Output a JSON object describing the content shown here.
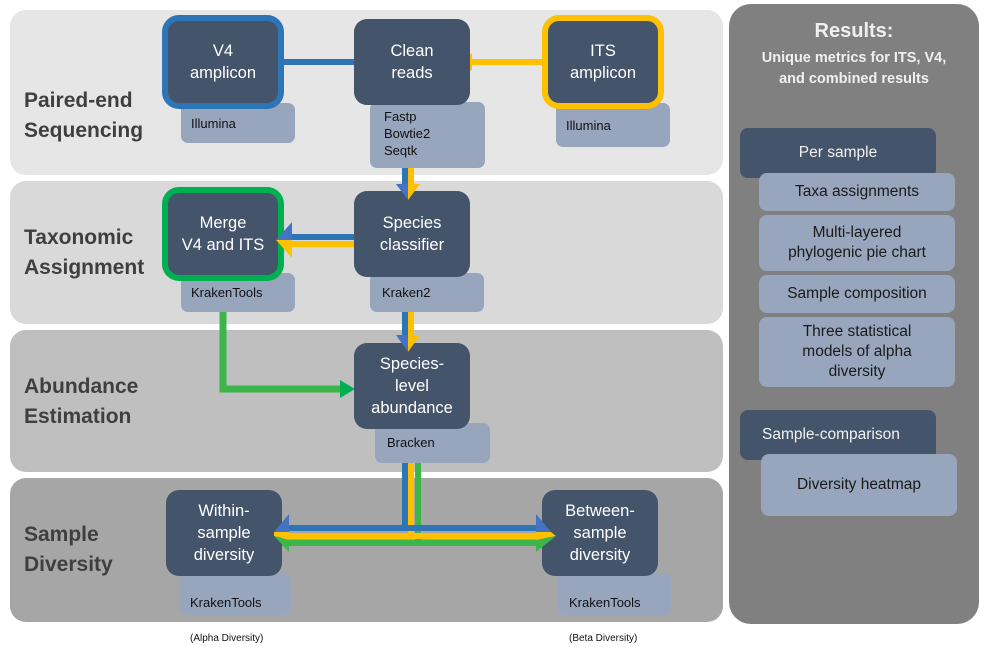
{
  "colors": {
    "v4": "#2e75b6",
    "its": "#ffc000",
    "merged": "#3cb54a",
    "node_fill": "#44546a",
    "tool_fill": "#97a6bd",
    "band_1": "#e6e6e6",
    "band_2": "#d9d9d9",
    "band_3": "#bfbfbf",
    "band_4": "#a6a6a6",
    "results_panel": "#808080"
  },
  "stages": [
    {
      "label": "Paired-end\nSequencing"
    },
    {
      "label": "Taxonomic\nAssignment"
    },
    {
      "label": "Abundance\nEstimation"
    },
    {
      "label": "Sample\nDiversity"
    }
  ],
  "nodes": {
    "v4_amplicon": {
      "label": "V4\namplicon",
      "tool": "Illumina"
    },
    "clean_reads": {
      "label": "Clean\nreads",
      "tool": "Fastp\nBowtie2\nSeqtk"
    },
    "its_amplicon": {
      "label": "ITS\namplicon",
      "tool": "Illumina"
    },
    "merge": {
      "label": "Merge\nV4 and ITS",
      "tool": "KrakenTools"
    },
    "species_classifier": {
      "label": "Species\nclassifier",
      "tool": "Kraken2"
    },
    "species_abundance": {
      "label": "Species-\nlevel\nabundance",
      "tool": "Bracken"
    },
    "within_sample": {
      "label": "Within-\nsample\ndiversity",
      "tool": "KrakenTools",
      "tool_note": "(Alpha Diversity)"
    },
    "between_sample": {
      "label": "Between-\nsample\ndiversity",
      "tool": "KrakenTools",
      "tool_note": "(Beta Diversity)"
    }
  },
  "results": {
    "title": "Results:",
    "subtitle": "Unique metrics for ITS, V4,\nand combined results",
    "per_sample": {
      "heading": "Per sample",
      "items": [
        "Taxa assignments",
        "Multi-layered\nphylogenic pie chart",
        "Sample composition",
        "Three statistical\nmodels of alpha\ndiversity"
      ]
    },
    "sample_comparison": {
      "heading": "Sample-comparison",
      "items": [
        "Diversity heatmap"
      ]
    }
  }
}
